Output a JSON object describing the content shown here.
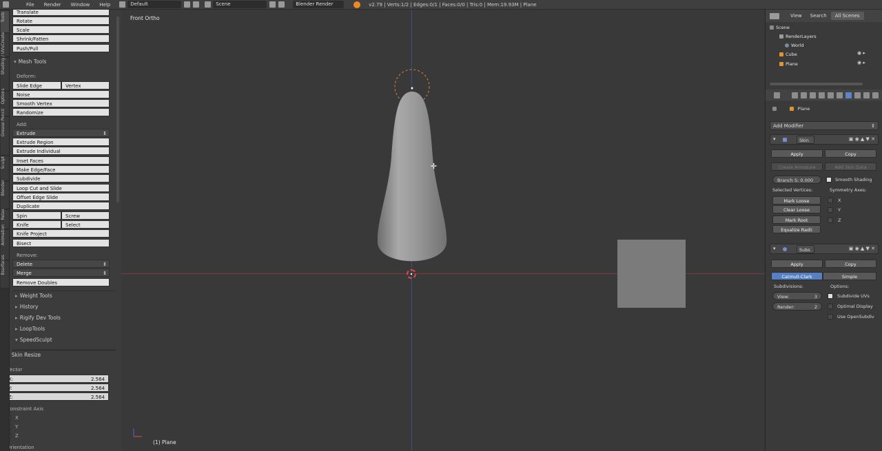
{
  "topbar": {
    "menus": [
      "File",
      "Render",
      "Window",
      "Help"
    ],
    "layout": "Default",
    "scene": "Scene",
    "engine": "Blender Render",
    "stats": "v2.79 | Verts:1/2 | Edges:0/1 | Faces:0/0 | Tris:0 | Mem:19.93M | Plane"
  },
  "tabs": [
    "Tools",
    "Create",
    "Shading / UVs",
    "Options",
    "Grease Pencil",
    "Sculpt",
    "Blender",
    "Relax",
    "Animation",
    "Bsurfaces"
  ],
  "shelf": {
    "transform_items": [
      "Translate",
      "Rotate",
      "Scale",
      "Shrink/Fatten",
      "Push/Pull"
    ],
    "mesh_tools_title": "Mesh Tools",
    "deform_label": "Deform:",
    "slide_edge": "Slide Edge",
    "vertex": "Vertex",
    "noise": "Noise",
    "smooth_vertex": "Smooth Vertex",
    "randomize": "Randomize",
    "add_label": "Add:",
    "extrude": "Extrude",
    "extrude_region": "Extrude Region",
    "extrude_individual": "Extrude Individual",
    "inset_faces": "Inset Faces",
    "make_edge_face": "Make Edge/Face",
    "subdivide": "Subdivide",
    "loop_cut": "Loop Cut and Slide",
    "offset_edge": "Offset Edge Slide",
    "duplicate": "Duplicate",
    "spin": "Spin",
    "screw": "Screw",
    "knife": "Knife",
    "select": "Select",
    "knife_project": "Knife Project",
    "bisect": "Bisect",
    "remove_label": "Remove:",
    "delete": "Delete",
    "merge": "Merge",
    "remove_doubles": "Remove Doubles",
    "panels": [
      "Weight Tools",
      "History",
      "Rigify Dev Tools",
      "LoopTools",
      "SpeedSculpt"
    ],
    "skin_resize": "Skin Resize",
    "vector_label": "Vector",
    "vector": {
      "x_label": "X:",
      "x": "2.564",
      "y_label": "Y:",
      "y": "2.564",
      "z_label": "Z:",
      "z": "2.564"
    },
    "constraint_axis": "Constraint Axis",
    "axes": [
      "X",
      "Y",
      "Z"
    ],
    "orientation": "Orientation"
  },
  "viewport": {
    "title": "Front Ortho",
    "object": "(1) Plane"
  },
  "outliner": {
    "tabs": [
      "View",
      "Search",
      "All Scenes"
    ],
    "tree": [
      "Scene",
      "RenderLayers",
      "World",
      "Cube",
      "Plane"
    ]
  },
  "properties": {
    "object_name": "Plane",
    "add_modifier": "Add Modifier",
    "skin": {
      "name": "Skin",
      "apply": "Apply",
      "copy": "Copy",
      "create_armature": "Create Armature",
      "add_skin_data": "Add Skin Data",
      "branch_smoothing": "Branch S: 0.000",
      "smooth_shading": "Smooth Shading",
      "selected_vertices": "Selected Vertices:",
      "symmetry_axes": "Symmetry Axes:",
      "mark_loose": "Mark Loose",
      "clear_loose": "Clear Loose",
      "mark_root": "Mark Root",
      "equalize_radii": "Equalize Radii",
      "axes": [
        "X",
        "Y",
        "Z"
      ]
    },
    "subsurf": {
      "name": "Subs",
      "apply": "Apply",
      "copy": "Copy",
      "catmull": "Catmull-Clark",
      "simple": "Simple",
      "subdivisions": "Subdivisions:",
      "options": "Options:",
      "view_label": "View:",
      "view": "3",
      "render_label": "Render:",
      "render": "2",
      "subdivide_uvs": "Subdivide UVs",
      "optimal_display": "Optimal Display",
      "use_opensubdiv": "Use OpenSubdiv"
    }
  },
  "colors": {
    "accent_blue": "#5680c2",
    "x_axis": "#7a3a3a",
    "z_axis": "#3e4c78",
    "cursor_red": "#d84a4a",
    "logo_orange": "#e88a2a"
  }
}
